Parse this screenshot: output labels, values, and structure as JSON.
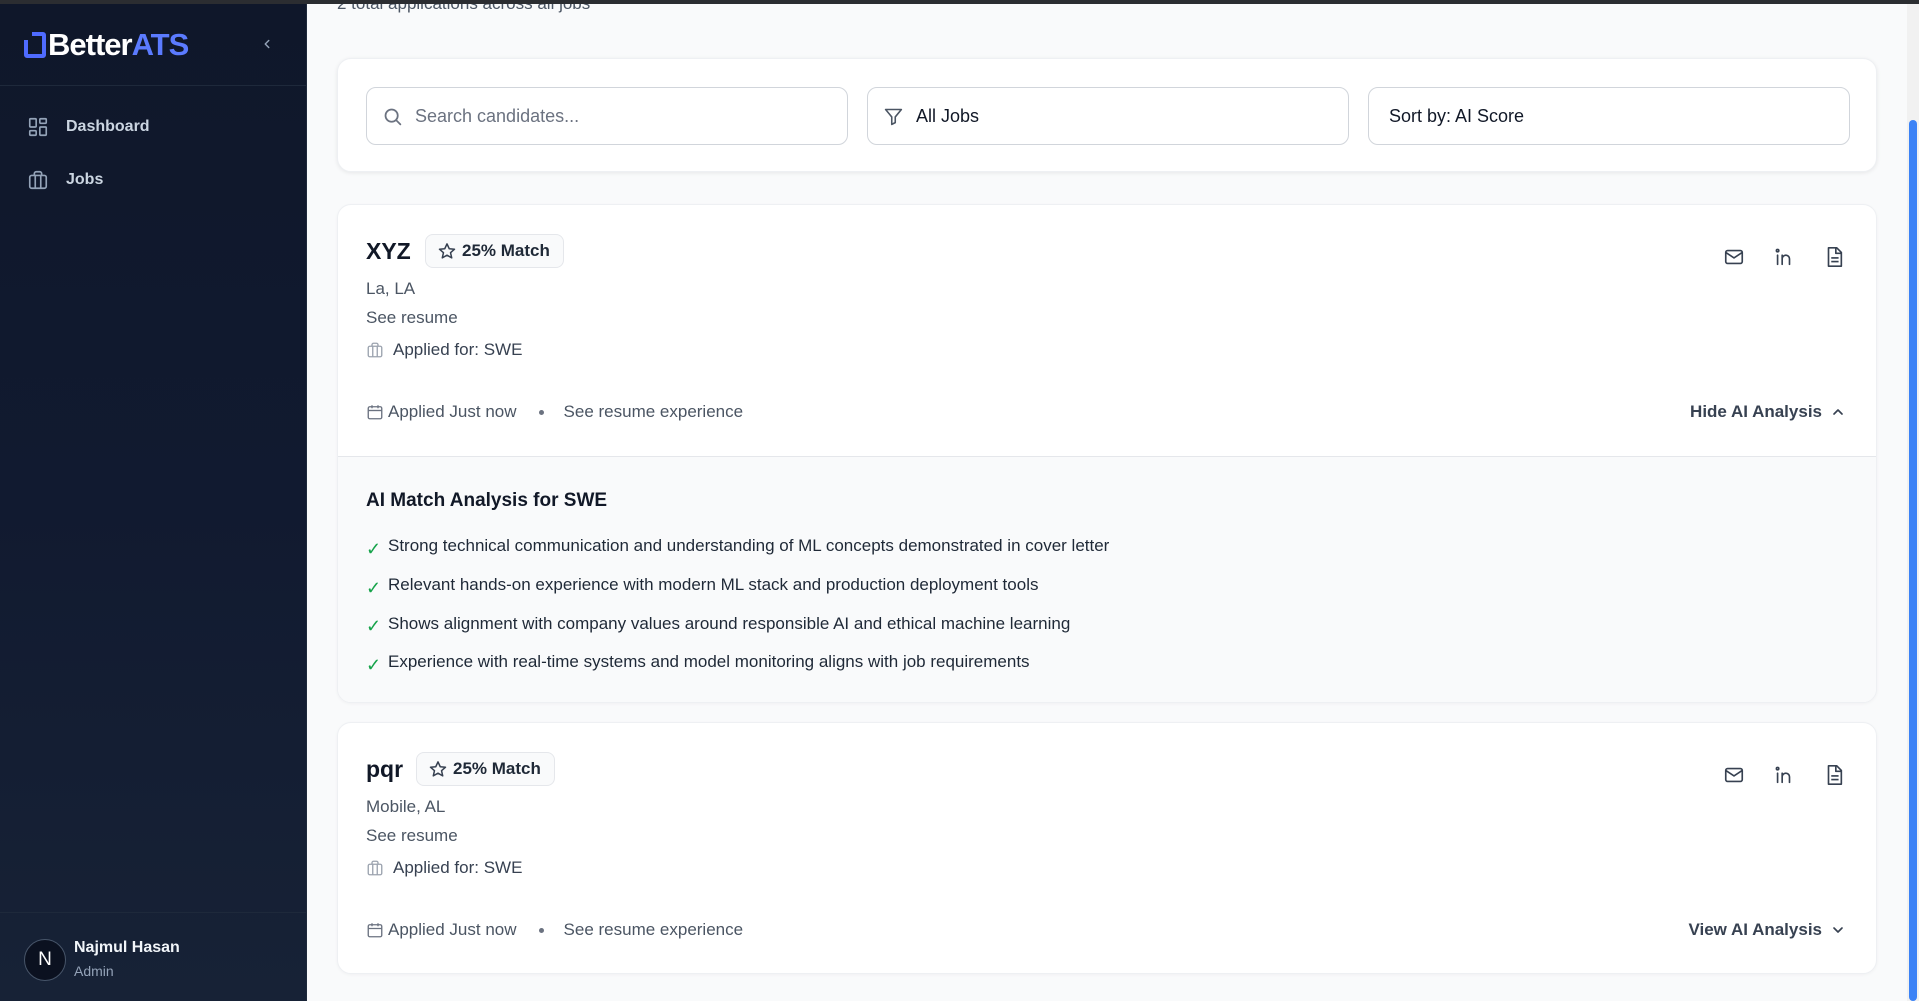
{
  "app": {
    "logo_prefix": "Better",
    "logo_accent": "ATS",
    "brand_color": "#5b7bff"
  },
  "sidebar": {
    "collapse_icon": "chevron-left-icon",
    "items": [
      {
        "label": "Dashboard",
        "icon": "dashboard-grid-icon"
      },
      {
        "label": "Jobs",
        "icon": "briefcase-icon"
      }
    ],
    "user": {
      "initial": "N",
      "name": "Najmul Hasan",
      "role": "Admin"
    }
  },
  "main": {
    "subtitle": "2 total applications across all jobs",
    "filters": {
      "search_placeholder": "Search candidates...",
      "search_value": "",
      "job_filter": "All Jobs",
      "sort": "Sort by: AI Score"
    },
    "candidates": [
      {
        "name": "XYZ",
        "match": "25% Match",
        "location": "La, LA",
        "see_resume": "See resume",
        "applied_for": "Applied for: SWE",
        "applied": "Applied Just now",
        "experience": "See resume experience",
        "toggle": "Hide AI Analysis",
        "analysis_title": "AI Match Analysis for SWE",
        "analysis": [
          "Strong technical communication and understanding of ML concepts demonstrated in cover letter",
          "Relevant hands-on experience with modern ML stack and production deployment tools",
          "Shows alignment with company values around responsible AI and ethical machine learning",
          "Experience with real-time systems and model monitoring aligns with job requirements"
        ]
      },
      {
        "name": "pqr",
        "match": "25% Match",
        "location": "Mobile, AL",
        "see_resume": "See resume",
        "applied_for": "Applied for: SWE",
        "applied": "Applied Just now",
        "experience": "See resume experience",
        "toggle": "View AI Analysis"
      }
    ]
  }
}
